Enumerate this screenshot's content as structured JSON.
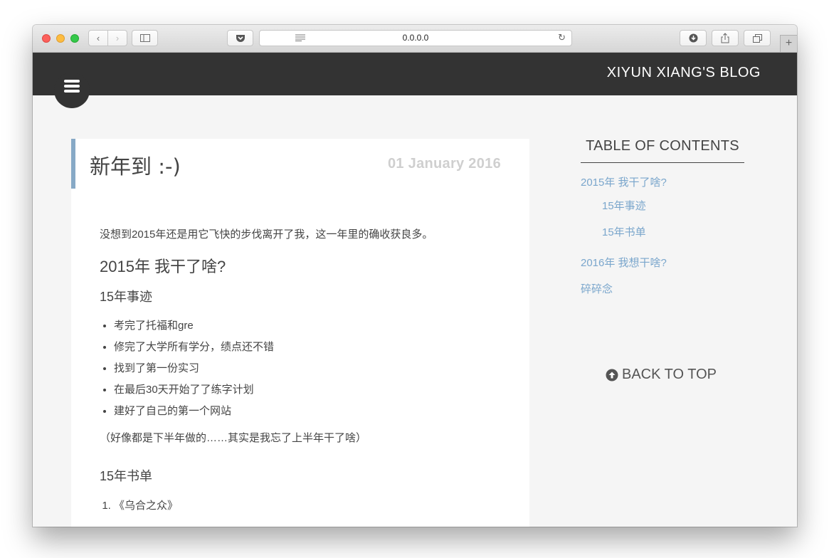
{
  "browser": {
    "url": "0.0.0.0"
  },
  "site": {
    "title": "XIYUN XIANG'S BLOG"
  },
  "post": {
    "title": "新年到 :-)",
    "date": "01 January 2016",
    "intro": "没想到2015年还是用它飞快的步伐离开了我，这一年里的确收获良多。",
    "section_2015": "2015年 我干了啥?",
    "sub_deeds": "15年事迹",
    "deeds": [
      "考完了托福和gre",
      "修完了大学所有学分，绩点还不错",
      "找到了第一份实习",
      "在最后30天开始了了练字计划",
      "建好了自己的第一个网站"
    ],
    "aside": "（好像都是下半年做的……其实是我忘了上半年干了啥）",
    "sub_books": "15年书单",
    "books": [
      "《乌合之众》"
    ]
  },
  "toc": {
    "title": "TABLE OF CONTENTS",
    "items": [
      "2015年 我干了啥?",
      "15年事迹",
      "15年书单",
      "2016年 我想干啥?",
      "碎碎念"
    ]
  },
  "back_to_top": {
    "label": "BACK TO TOP"
  },
  "colors": {
    "header_bg": "#333333",
    "accent": "#87a9c6",
    "link": "#7aa6cc"
  }
}
